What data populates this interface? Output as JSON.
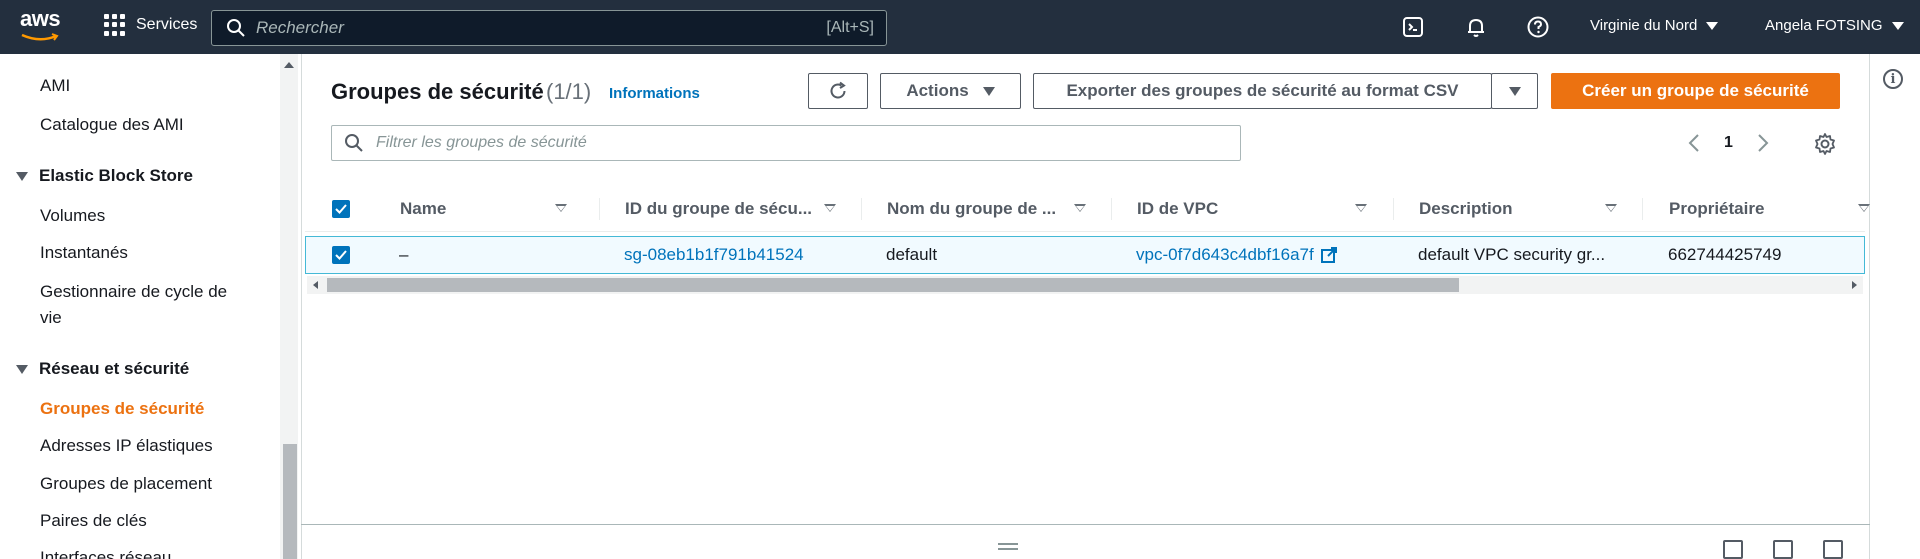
{
  "topnav": {
    "logo": "aws",
    "services_label": "Services",
    "search_placeholder": "Rechercher",
    "search_shortcut": "[Alt+S]",
    "region": "Virginie du Nord",
    "user": "Angela FOTSING",
    "icons": [
      "cloudshell-icon",
      "bell-icon",
      "help-icon"
    ]
  },
  "sidebar": {
    "items": [
      {
        "label": "AMI"
      },
      {
        "label": "Catalogue des AMI"
      }
    ],
    "sections": [
      {
        "title": "Elastic Block Store",
        "items": [
          "Volumes",
          "Instantanés",
          "Gestionnaire de cycle de",
          "vie"
        ]
      },
      {
        "title": "Réseau et sécurité",
        "items": [
          "Groupes de sécurité",
          "Adresses IP élastiques",
          "Groupes de placement",
          "Paires de clés",
          "Interfaces réseau"
        ]
      }
    ],
    "active": "Groupes de sécurité"
  },
  "header": {
    "title": "Groupes de sécurité",
    "count": "(1/1)",
    "info": "Informations"
  },
  "toolbar": {
    "refresh": "refresh-icon",
    "actions": "Actions",
    "export": "Exporter des groupes de sécurité au format CSV",
    "create": "Créer un groupe de sécurité"
  },
  "filter": {
    "placeholder": "Filtrer les groupes de sécurité"
  },
  "pagination": {
    "page": "1"
  },
  "table": {
    "columns": [
      "Name",
      "ID du groupe de sécu...",
      "Nom du groupe de ...",
      "ID de VPC",
      "Description",
      "Propriétaire"
    ],
    "rows": [
      {
        "selected": true,
        "name": "–",
        "group_id": "sg-08eb1b1f791b41524",
        "group_name": "default",
        "vpc_id": "vpc-0f7d643c4dbf16a7f",
        "description": "default VPC security gr...",
        "owner": "662744425749"
      }
    ]
  },
  "colors": {
    "nav_bg": "#232f3e",
    "accent": "#ec7211",
    "link": "#0073bb"
  }
}
